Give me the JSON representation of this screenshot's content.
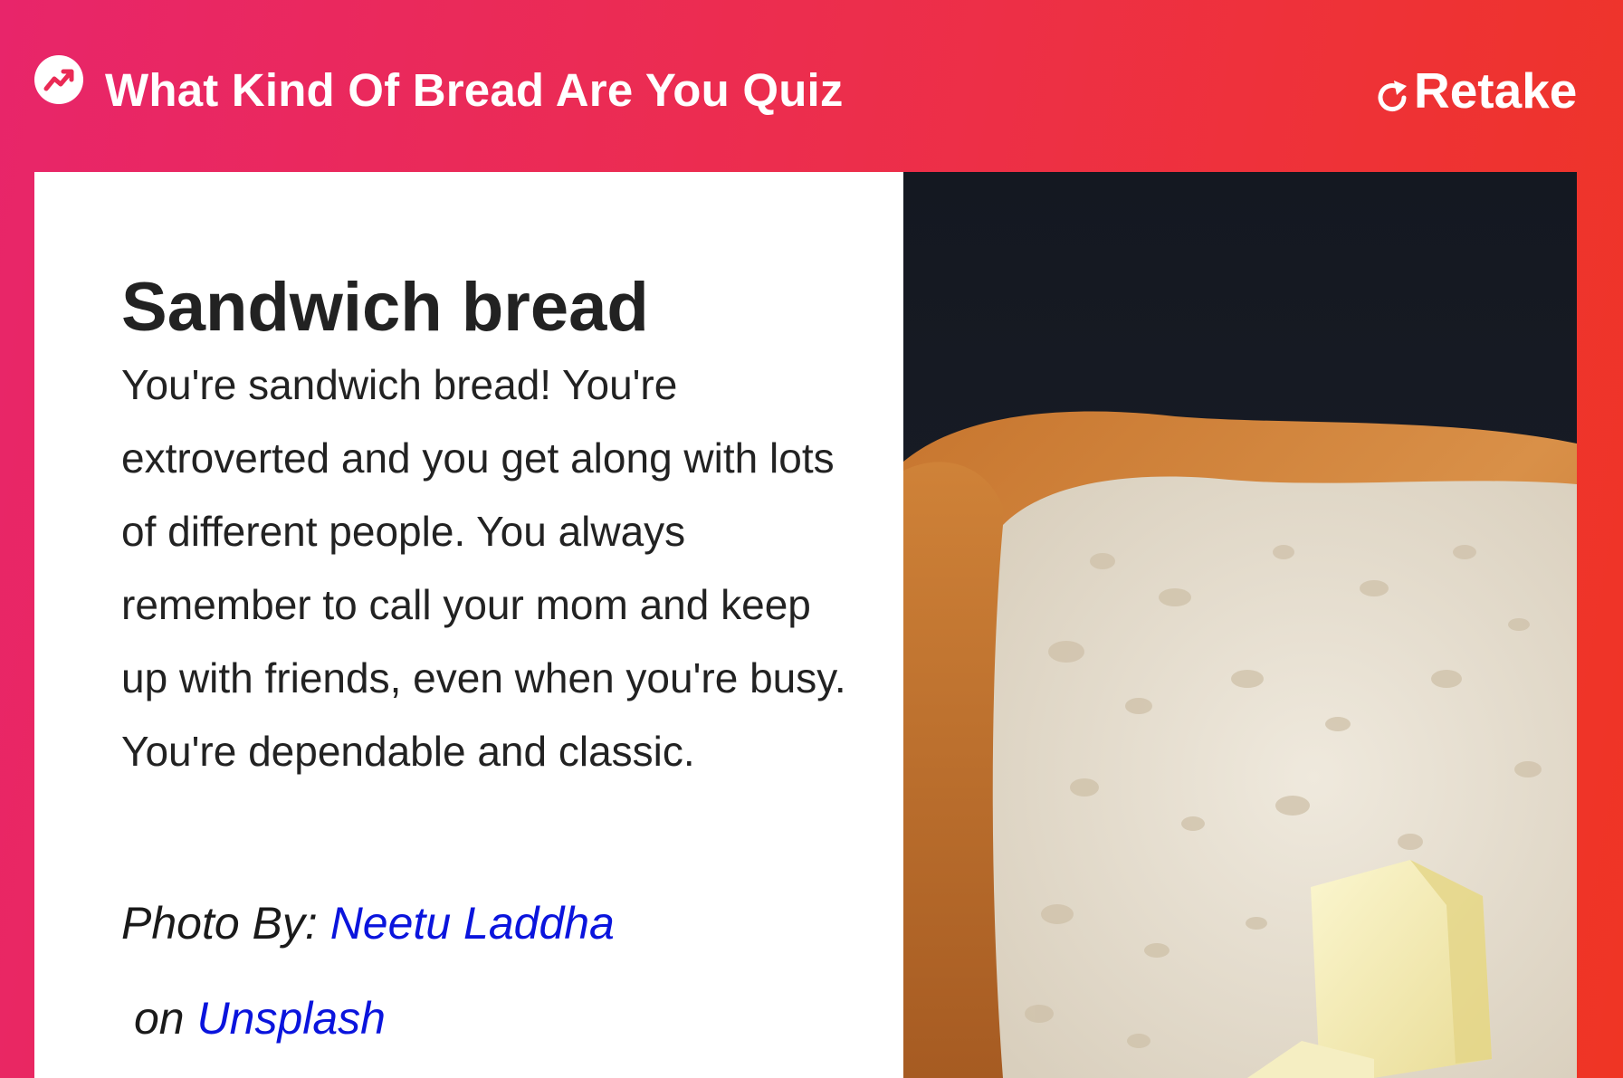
{
  "header": {
    "title": "What Kind Of Bread Are You Quiz",
    "icon": "trending-icon",
    "retake_label": "Retake",
    "retake_icon": "refresh-icon"
  },
  "result": {
    "title": "Sandwich bread",
    "description": "You're sandwich bread! You're extroverted and you get along with lots of different people. You always remember to call your mom and keep up with friends, even when you're busy. You're dependable and classic.",
    "photo_by_label": "Photo By:",
    "photographer": "Neetu Laddha",
    "on_label": "on",
    "source": "Unsplash",
    "image_icon": "sandwich-bread-photo"
  },
  "colors": {
    "brand_gradient_start": "#e8256a",
    "brand_gradient_end": "#ef3524",
    "link": "#0a14dd",
    "text": "#222222"
  }
}
